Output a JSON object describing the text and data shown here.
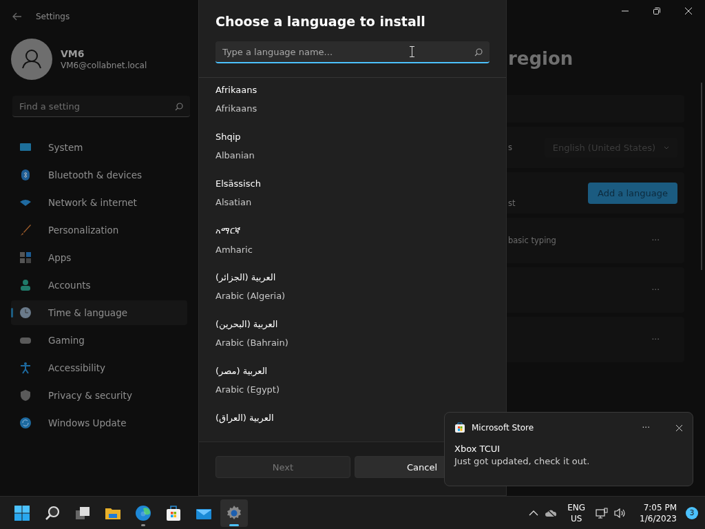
{
  "window": {
    "title": "Settings"
  },
  "user": {
    "name": "VM6",
    "email": "VM6@collabnet.local"
  },
  "search": {
    "placeholder": "Find a setting"
  },
  "nav": [
    {
      "label": "System",
      "selected": false
    },
    {
      "label": "Bluetooth & devices",
      "selected": false
    },
    {
      "label": "Network & internet",
      "selected": false
    },
    {
      "label": "Personalization",
      "selected": false
    },
    {
      "label": "Apps",
      "selected": false
    },
    {
      "label": "Accounts",
      "selected": false
    },
    {
      "label": "Time & language",
      "selected": true
    },
    {
      "label": "Gaming",
      "selected": false
    },
    {
      "label": "Accessibility",
      "selected": false
    },
    {
      "label": "Privacy & security",
      "selected": false
    },
    {
      "label": "Windows Update",
      "selected": false
    }
  ],
  "page": {
    "title": "region",
    "display_label": "s",
    "display_value": "English (United States)",
    "preferred_label": "st",
    "add_button": "Add a language",
    "language_rows": [
      {
        "detail": "basic typing",
        "more": "···"
      },
      {
        "more": "···"
      },
      {
        "more": "···"
      }
    ]
  },
  "dialog": {
    "title": "Choose a language to install",
    "placeholder": "Type a language name...",
    "languages": [
      {
        "native": "Afrikaans",
        "english": "Afrikaans"
      },
      {
        "native": "Shqip",
        "english": "Albanian"
      },
      {
        "native": "Elsässisch",
        "english": "Alsatian"
      },
      {
        "native": "አማርኛ",
        "english": "Amharic"
      },
      {
        "native": "العربية (الجزائر)",
        "english": "Arabic (Algeria)"
      },
      {
        "native": "العربية (البحرين)",
        "english": "Arabic (Bahrain)"
      },
      {
        "native": "العربية (مصر)",
        "english": "Arabic (Egypt)"
      },
      {
        "native": "العربية (العراق)"
      }
    ],
    "buttons": [
      {
        "label": "Next",
        "disabled": true
      },
      {
        "label": "Cancel",
        "disabled": false
      }
    ]
  },
  "toast": {
    "app": "Microsoft Store",
    "more": "···",
    "title": "Xbox TCUI",
    "message": "Just got updated, check it out."
  },
  "taskbar": {
    "apps": [
      {
        "kind": "start",
        "active": false,
        "running": false
      },
      {
        "kind": "search",
        "active": false,
        "running": false
      },
      {
        "kind": "taskview",
        "active": false,
        "running": false
      },
      {
        "kind": "explorer",
        "active": false,
        "running": false
      },
      {
        "kind": "edge",
        "active": false,
        "running": true
      },
      {
        "kind": "store",
        "active": false,
        "running": false
      },
      {
        "kind": "mail",
        "active": false,
        "running": false
      },
      {
        "kind": "settings",
        "active": true,
        "running": true
      }
    ],
    "language": "ENG",
    "region": "US",
    "time": "7:05 PM",
    "date": "1/6/2023",
    "badge": "3"
  }
}
